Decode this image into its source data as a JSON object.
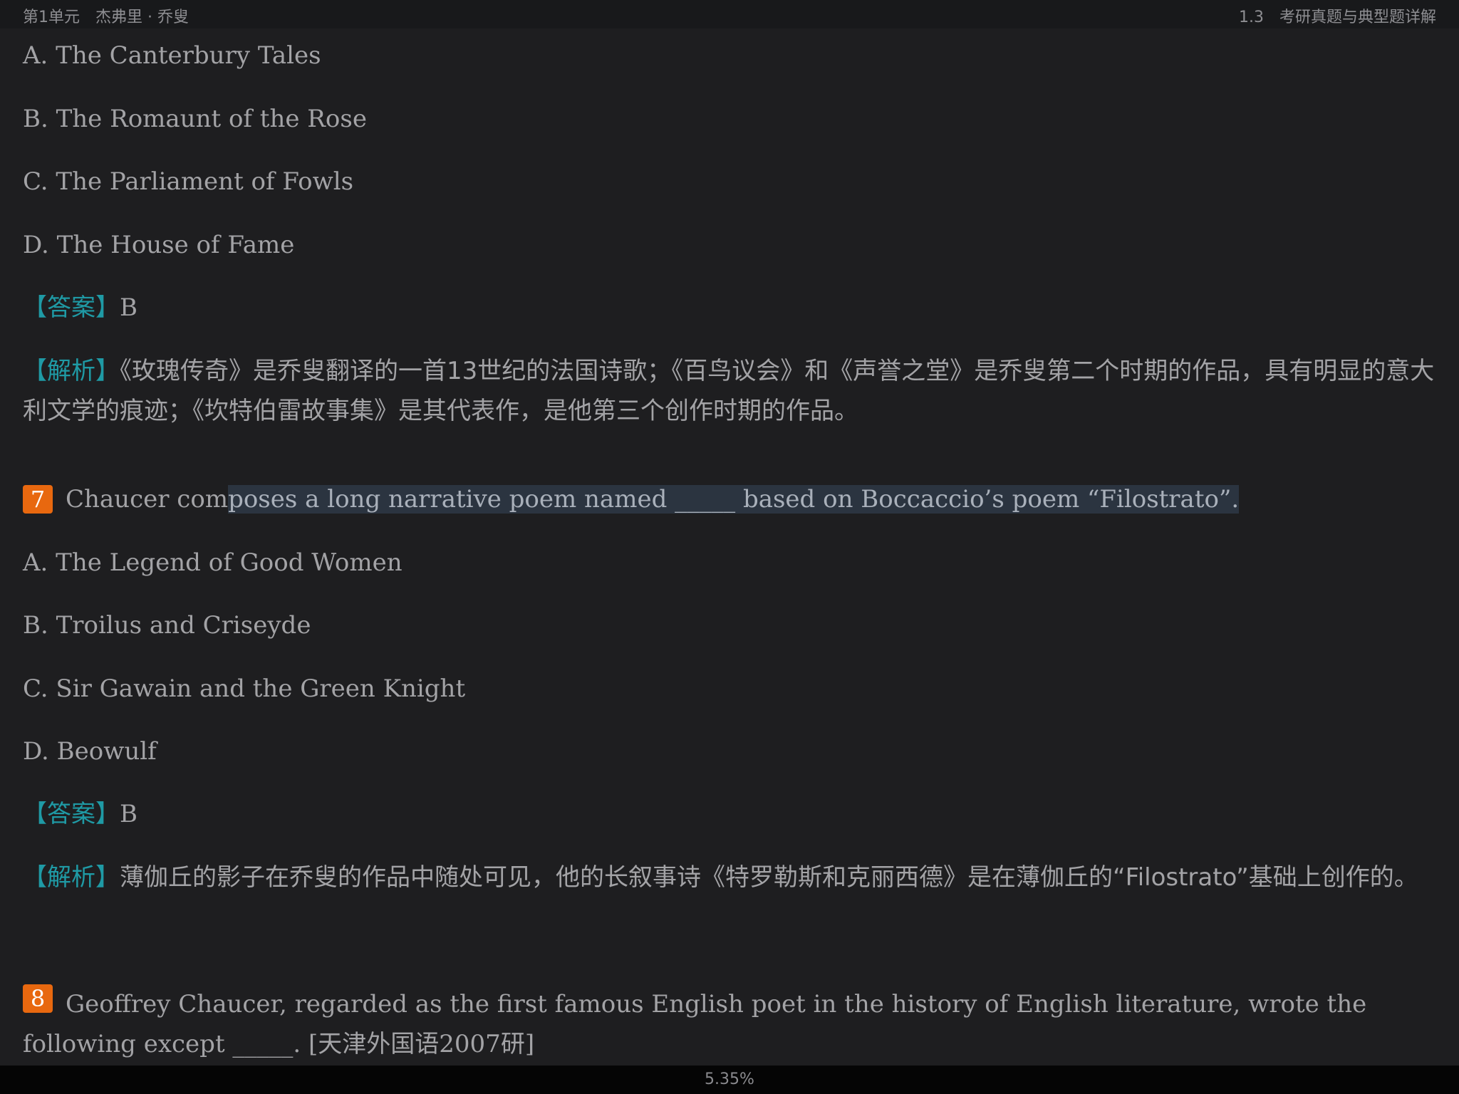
{
  "header": {
    "chapter": "第1单元",
    "author": "杰弗里 · 乔叟",
    "section_number": "1.3",
    "section_title": "考研真题与典型题详解"
  },
  "question6": {
    "options": [
      "A. The Canterbury Tales",
      "B. The Romaunt of the Rose",
      "C. The Parliament of Fowls",
      "D. The House of Fame"
    ],
    "answer_label": "【答案】",
    "answer": "B",
    "analysis_label": "【解析】",
    "analysis": "《玫瑰传奇》是乔叟翻译的一首13世纪的法国诗歌；《百鸟议会》和《声誉之堂》是乔叟第二个时期的作品，具有明显的意大利文学的痕迹；《坎特伯雷故事集》是其代表作，是他第三个创作时期的作品。"
  },
  "question7": {
    "number": "7",
    "stem_before": "Chaucer com",
    "stem_highlighted": "poses a long narrative poem named _____ based on Boccaccio’s poem “Filostrato”.",
    "options": [
      "A. The Legend of Good Women",
      "B. Troilus and Criseyde",
      "C. Sir Gawain and the Green Knight",
      "D. Beowulf"
    ],
    "answer_label": "【答案】",
    "answer": "B",
    "analysis_label": "【解析】",
    "analysis": "薄伽丘的影子在乔叟的作品中随处可见，他的长叙事诗《特罗勒斯和克丽西德》是在薄伽丘的“Filostrato”基础上创作的。"
  },
  "question8": {
    "number": "8",
    "stem": "Geoffrey Chaucer, regarded as the first famous English poet in the history of English literature, wrote the following except _____. [天津外国语2007研]"
  },
  "footer": {
    "progress": "5.35%"
  }
}
